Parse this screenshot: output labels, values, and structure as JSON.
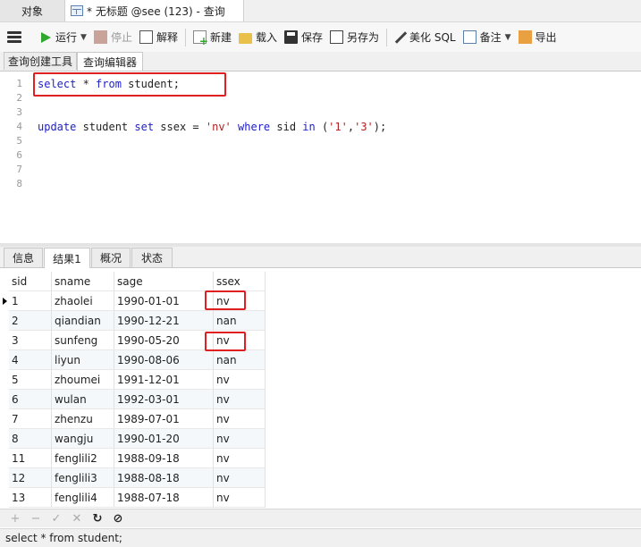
{
  "tabs": {
    "objects": "对象",
    "query": "* 无标题 @see (123) - 查询"
  },
  "toolbar": {
    "run": "运行",
    "stop": "停止",
    "explain": "解释",
    "new": "新建",
    "load": "载入",
    "save": "保存",
    "save_as": "另存为",
    "beautify": "美化 SQL",
    "comment": "备注",
    "export": "导出"
  },
  "editor_tabs": {
    "builder": "查询创建工具",
    "editor": "查询编辑器"
  },
  "editor": {
    "line_numbers": [
      "1",
      "2",
      "3",
      "4",
      "5",
      "6",
      "7",
      "8"
    ],
    "line1": [
      "select",
      " * ",
      "from",
      " student;"
    ],
    "line4": [
      "update",
      " student ",
      "set",
      " ssex = ",
      "'nv'",
      " ",
      "where",
      " sid ",
      "in",
      " (",
      "'1'",
      ",",
      "'3'",
      ");"
    ]
  },
  "result_tabs": {
    "info": "信息",
    "result1": "结果1",
    "profile": "概况",
    "status": "状态"
  },
  "grid": {
    "columns": [
      "sid",
      "sname",
      "sage",
      "ssex"
    ],
    "rows": [
      [
        "1",
        "zhaolei",
        "1990-01-01",
        "nv"
      ],
      [
        "2",
        "qiandian",
        "1990-12-21",
        "nan"
      ],
      [
        "3",
        "sunfeng",
        "1990-05-20",
        "nv"
      ],
      [
        "4",
        "liyun",
        "1990-08-06",
        "nan"
      ],
      [
        "5",
        "zhoumei",
        "1991-12-01",
        "nv"
      ],
      [
        "6",
        "wulan",
        "1992-03-01",
        "nv"
      ],
      [
        "7",
        "zhenzu",
        "1989-07-01",
        "nv"
      ],
      [
        "8",
        "wangju",
        "1990-01-20",
        "nv"
      ],
      [
        "11",
        "fenglili2",
        "1988-09-18",
        "nv"
      ],
      [
        "12",
        "fenglili3",
        "1988-08-18",
        "nv"
      ],
      [
        "13",
        "fenglili4",
        "1988-07-18",
        "nv"
      ]
    ]
  },
  "nav": {
    "add": "+",
    "delete": "−",
    "apply": "✓",
    "discard": "✕",
    "refresh": "↻",
    "stop": "⊘"
  },
  "status": {
    "sql": "select * from student;"
  }
}
